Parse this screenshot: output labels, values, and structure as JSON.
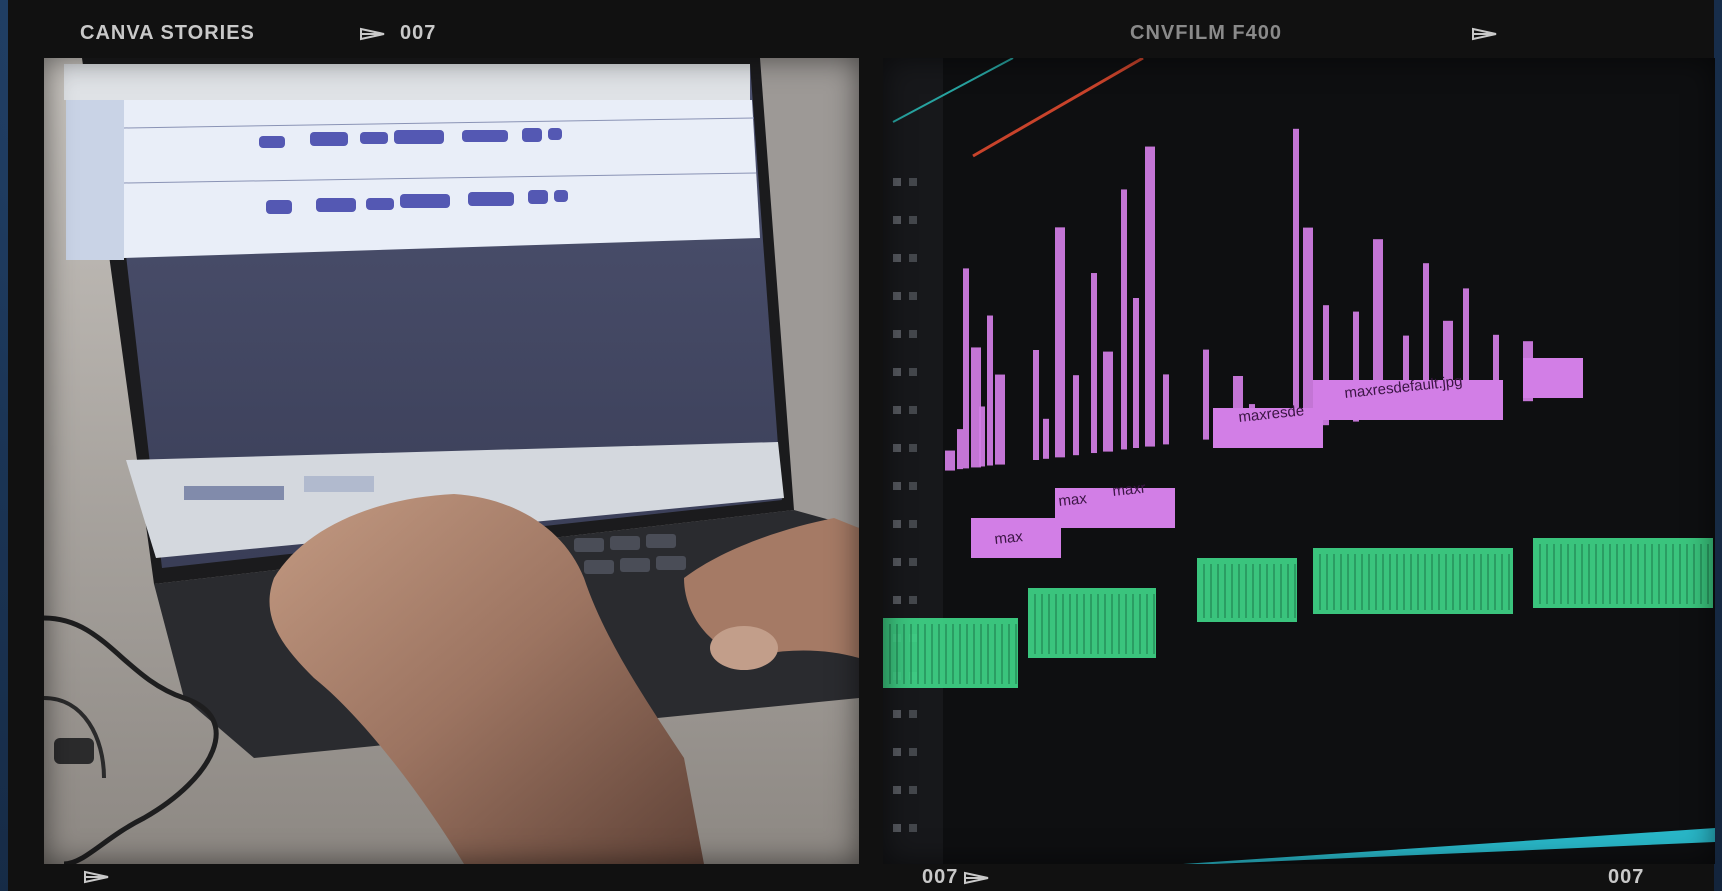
{
  "film_strip": {
    "brand_label": "CANVA STORIES",
    "frame_top_left": "007",
    "film_stock": "CNVFILM F400",
    "frame_bottom_center": "007",
    "frame_bottom_right": "007"
  },
  "photos": [
    {
      "subject": "laptop-audio-editing-photo"
    },
    {
      "subject": "video-editing-timeline-photo",
      "clip_labels": [
        "max",
        "max",
        "maxr",
        "maxresde",
        "maxresdefault.jpg"
      ]
    }
  ],
  "colors": {
    "background": "#1b3556",
    "film_frame": "#111111",
    "label_text": "#c9c9c9",
    "timeline_video_clip": "#d27ee6",
    "timeline_audio_clip": "#3fd88a"
  }
}
